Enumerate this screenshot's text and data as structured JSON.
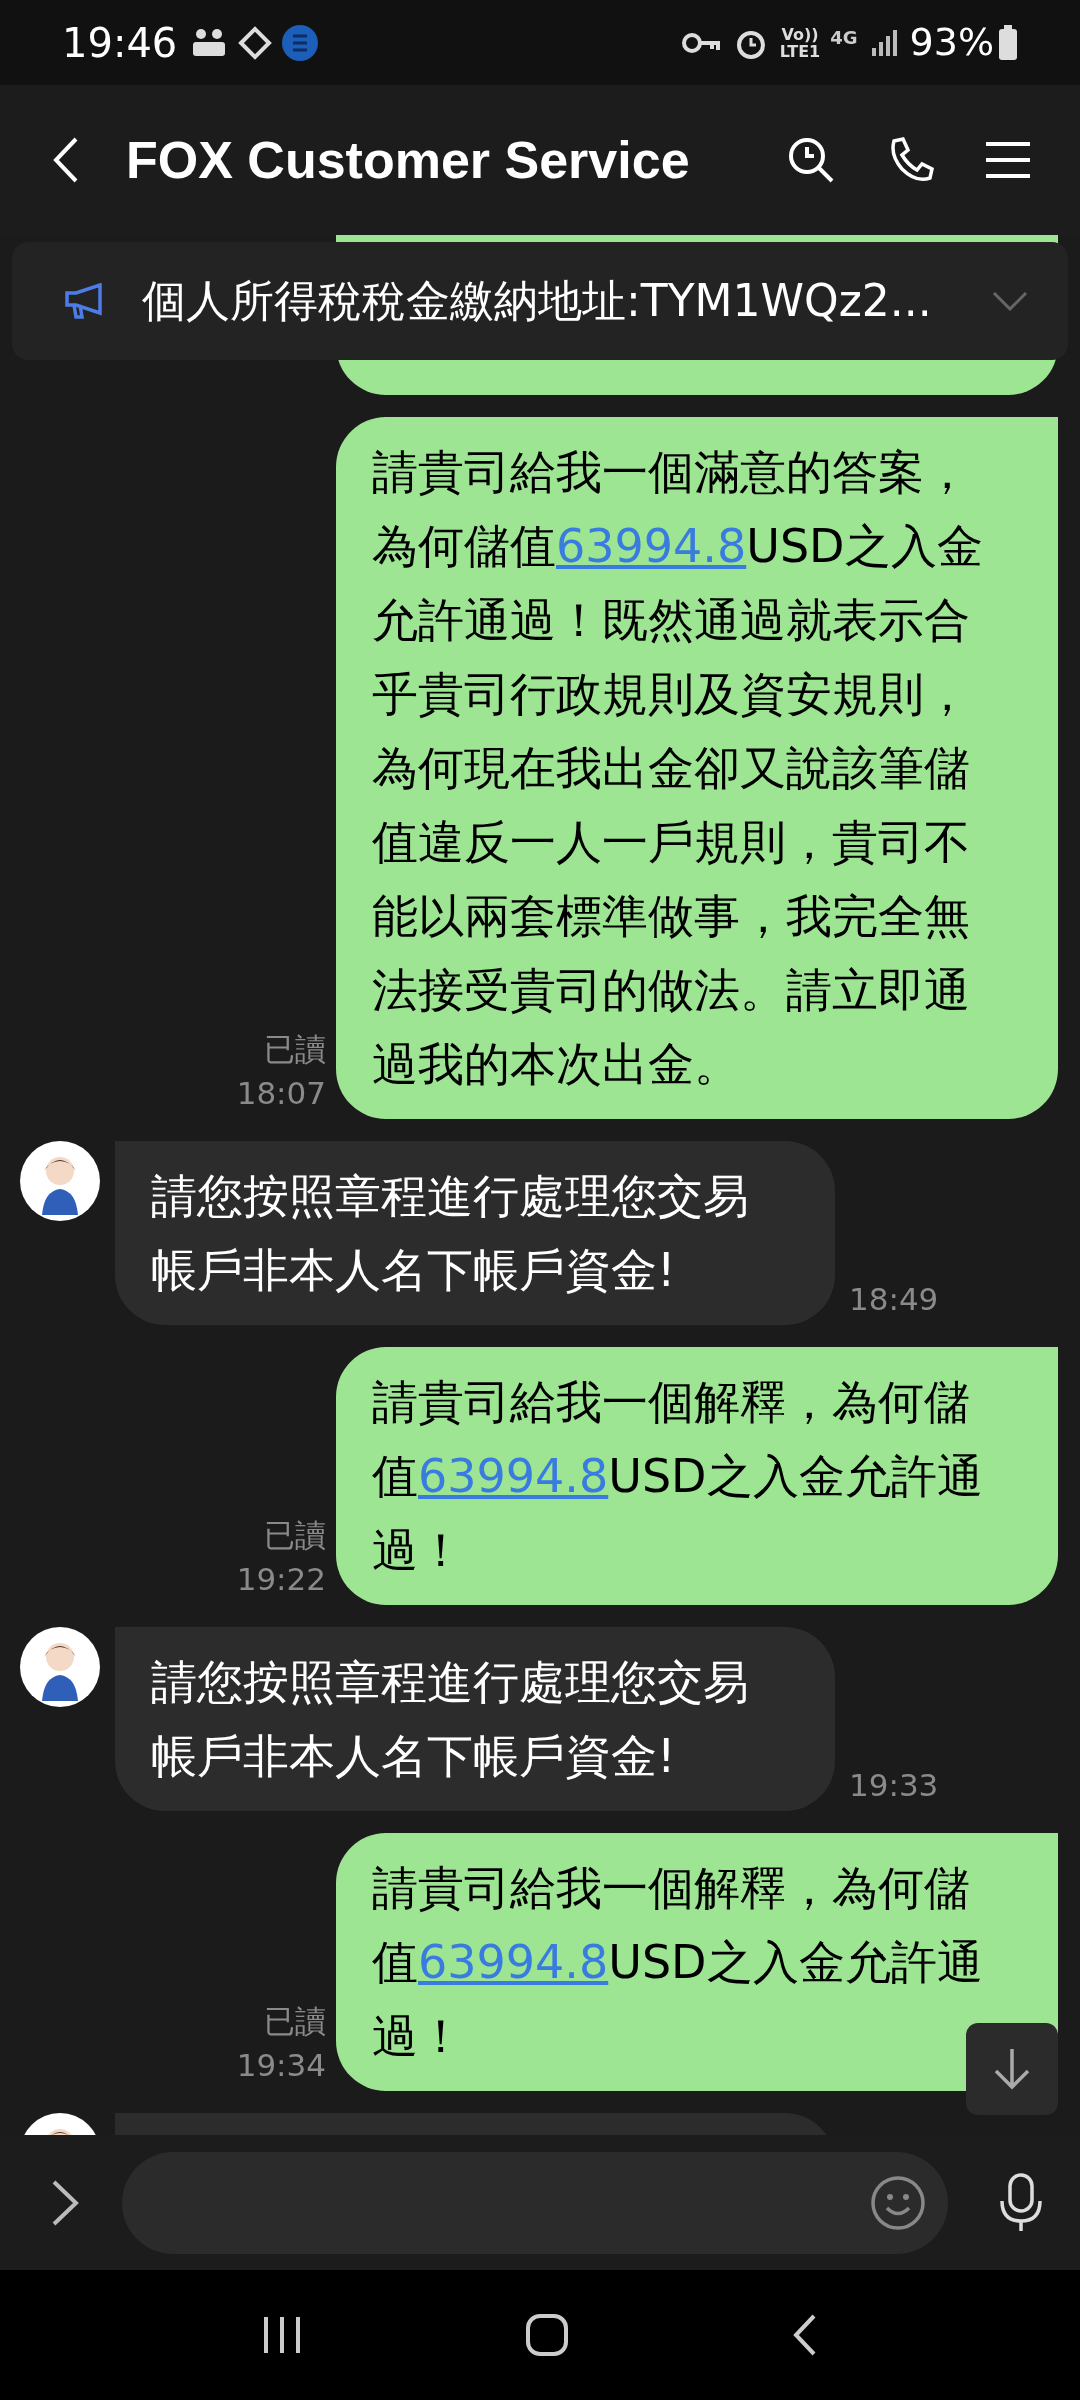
{
  "status_bar": {
    "time": "19:46",
    "volte": "Vo))",
    "lte": "LTE1",
    "network": "4G",
    "battery": "93%"
  },
  "header": {
    "title": "FOX Customer Service"
  },
  "announcement": {
    "text": "個人所得稅稅金繳納地址:TYM1WQz2..."
  },
  "messages": [
    {
      "kind": "outgoing",
      "read": "已讀",
      "time": "18:07",
      "parts": [
        {
          "kind": "text",
          "text": "請貴司給我一個滿意的答案，為何儲值"
        },
        {
          "kind": "link",
          "text": "63994.8"
        },
        {
          "kind": "text",
          "text": "USD之入金允許通過！既然通過就表示合乎貴司行政規則及資安規則，為何現在我出金卻又說該筆儲值違反一人一戶規則，貴司不能以兩套標準做事，我完全無法接受貴司的做法。請立即通過我的本次出金。"
        }
      ]
    },
    {
      "kind": "incoming",
      "time": "18:49",
      "parts": [
        {
          "kind": "text",
          "text": "請您按照章程進行處理您交易帳戶非本人名下帳戶資金!"
        }
      ]
    },
    {
      "kind": "outgoing",
      "read": "已讀",
      "time": "19:22",
      "parts": [
        {
          "kind": "text",
          "text": "請貴司給我一個解釋，為何儲值"
        },
        {
          "kind": "link",
          "text": "63994.8"
        },
        {
          "kind": "text",
          "text": "USD之入金允許通過！"
        }
      ]
    },
    {
      "kind": "incoming",
      "time": "19:33",
      "parts": [
        {
          "kind": "text",
          "text": "請您按照章程進行處理您交易帳戶非本人名下帳戶資金!"
        }
      ]
    },
    {
      "kind": "outgoing",
      "read": "已讀",
      "time": "19:34",
      "parts": [
        {
          "kind": "text",
          "text": "請貴司給我一個解釋，為何儲值"
        },
        {
          "kind": "link",
          "text": "63994.8"
        },
        {
          "kind": "text",
          "text": "USD之入金允許通過！"
        }
      ]
    }
  ]
}
